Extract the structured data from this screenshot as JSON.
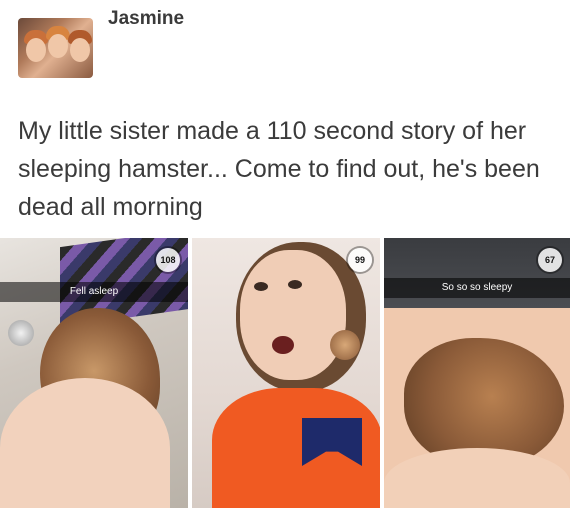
{
  "post": {
    "author": "Jasmine",
    "text": "My little sister made a 110 second story of her sleeping hamster... Come to find out, he's been dead all morning"
  },
  "photos": [
    {
      "timer": "108",
      "caption": "Fell asleep"
    },
    {
      "timer": "99",
      "caption": ""
    },
    {
      "timer": "67",
      "caption": "So so so sleepy"
    }
  ],
  "icons": {
    "avatar": "profile-photo"
  }
}
